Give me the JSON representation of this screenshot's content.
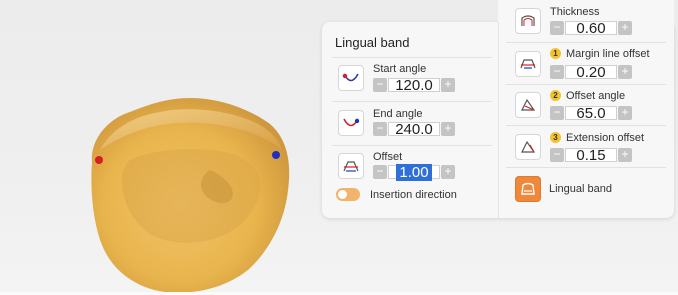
{
  "left_column": {
    "title": "Lingual band",
    "start_angle": {
      "label": "Start angle",
      "value": "120.0",
      "minus": "−",
      "plus": "+"
    },
    "end_angle": {
      "label": "End angle",
      "value": "240.0",
      "minus": "−",
      "plus": "+"
    },
    "offset": {
      "label": "Offset",
      "value": "1.00",
      "minus": "−",
      "plus": "+"
    },
    "insertion_direction": {
      "label": "Insertion direction",
      "enabled": false
    }
  },
  "right_column": {
    "thickness": {
      "label": "Thickness",
      "value": "0.60",
      "minus": "−",
      "plus": "+"
    },
    "margin_line_offset": {
      "badge": "1",
      "label": "Margin line offset",
      "value": "0.20",
      "minus": "−",
      "plus": "+"
    },
    "offset_angle": {
      "badge": "2",
      "label": "Offset angle",
      "value": "65.0",
      "minus": "−",
      "plus": "+"
    },
    "extension_offset": {
      "badge": "3",
      "label": "Extension offset",
      "value": "0.15",
      "minus": "−",
      "plus": "+"
    },
    "lingual_band_button": {
      "label": "Lingual band"
    }
  },
  "colors": {
    "tooth": "#e8b44c",
    "accent_orange": "#f0883a",
    "selection_blue": "#2f6fd8",
    "start_marker": "#d42020",
    "end_marker": "#1f2fc4"
  },
  "icons": {
    "start_angle": "arc-red-start-icon",
    "end_angle": "arc-blue-end-icon",
    "offset": "offset-profile-icon",
    "thickness": "thickness-icon",
    "margin_line_offset": "margin-line-icon",
    "offset_angle": "angle-icon",
    "extension_offset": "extension-icon",
    "lingual_band": "lingual-band-icon"
  }
}
